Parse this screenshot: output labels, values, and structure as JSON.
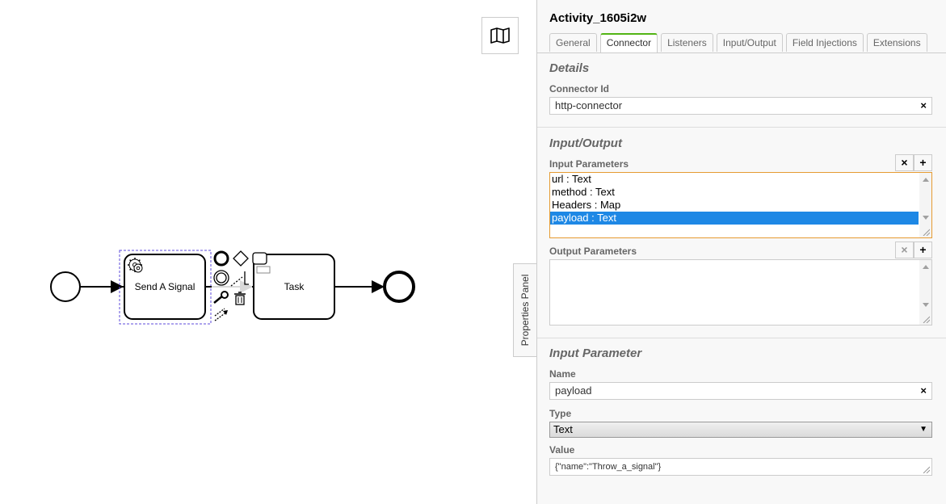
{
  "canvas": {
    "tasks": [
      {
        "label": "Send A Signal",
        "type": "service-task"
      },
      {
        "label": "Task",
        "type": "task"
      }
    ],
    "toggle_label": "Properties Panel",
    "icons": [
      "map-icon",
      "gear-icon",
      "wrench-icon",
      "trash-icon",
      "connect-icon"
    ]
  },
  "panel": {
    "title": "Activity_1605i2w",
    "tabs": [
      {
        "label": "General",
        "active": false
      },
      {
        "label": "Connector",
        "active": true
      },
      {
        "label": "Listeners",
        "active": false
      },
      {
        "label": "Input/Output",
        "active": false
      },
      {
        "label": "Field Injections",
        "active": false
      },
      {
        "label": "Extensions",
        "active": false
      }
    ],
    "details": {
      "group_title": "Details",
      "connector_id_label": "Connector Id",
      "connector_id_value": "http-connector",
      "clear_symbol": "×"
    },
    "io": {
      "group_title": "Input/Output",
      "input_label": "Input Parameters",
      "input_params": [
        "url : Text",
        "method : Text",
        "Headers : Map",
        "payload : Text"
      ],
      "selected_index": 3,
      "output_label": "Output Parameters",
      "remove_symbol": "×",
      "add_symbol": "+"
    },
    "param": {
      "group_title": "Input Parameter",
      "name_label": "Name",
      "name_value": "payload",
      "type_label": "Type",
      "type_value": "Text",
      "value_label": "Value",
      "value_value": "{\"name\":\"Throw_a_signal\"}"
    }
  },
  "colors": {
    "active_tab_accent": "#52b415",
    "selection": "#1e88e5",
    "focus_border": "#e69b32"
  }
}
